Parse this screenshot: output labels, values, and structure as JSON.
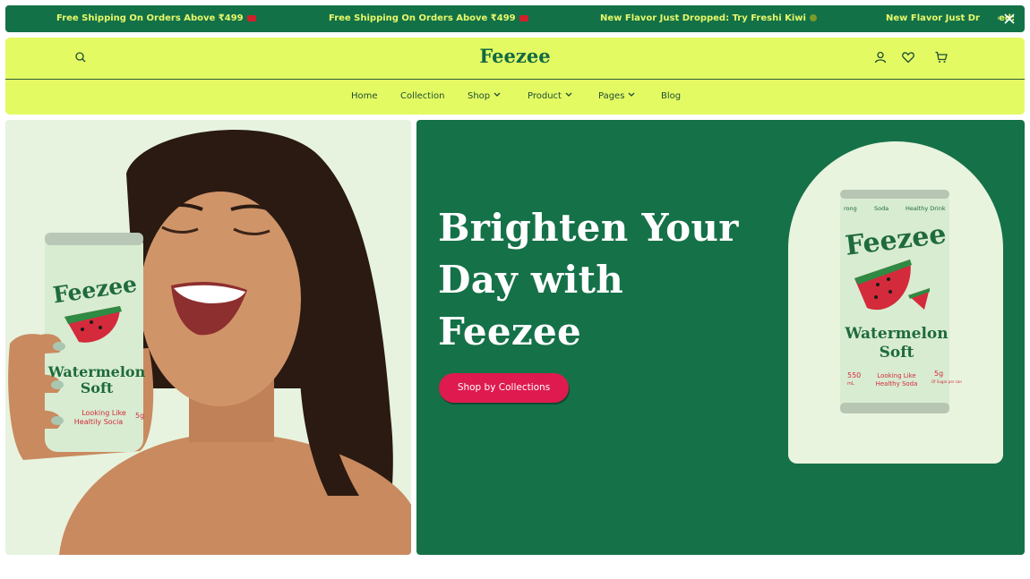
{
  "announcement": {
    "messages": [
      "Free Shipping On Orders Above ₹499",
      "Free Shipping On Orders Above ₹499",
      "New Flavor Just Dropped: Try Freshi Kiwi",
      "New Flavor Just Dropped:"
    ],
    "close_icon": "close-icon"
  },
  "header": {
    "logo": "Feezee",
    "icons": [
      "search-icon",
      "user-icon",
      "heart-icon",
      "cart-icon"
    ],
    "nav": [
      {
        "label": "Home",
        "dropdown": false
      },
      {
        "label": "Collection",
        "dropdown": false
      },
      {
        "label": "Shop",
        "dropdown": true
      },
      {
        "label": "Product",
        "dropdown": true
      },
      {
        "label": "Pages",
        "dropdown": true
      },
      {
        "label": "Blog",
        "dropdown": false
      }
    ]
  },
  "hero": {
    "headline_lines": [
      "Brighten Your",
      "Day with",
      "Feezee"
    ],
    "cta_label": "Shop by Collections",
    "left_can": {
      "brand": "Feezee",
      "flavor_line1": "Watermelon",
      "flavor_line2": "Soft",
      "tag_line1": "Looking Like",
      "tag_line2": "Healtily Socia",
      "stat": "5g"
    },
    "right_can": {
      "top_labels": [
        "rong",
        "Soda",
        "Healthy Drink"
      ],
      "brand": "Feezee",
      "flavor_line1": "Watermelon",
      "flavor_line2": "Soft",
      "volume": "550",
      "volume_unit": "mL",
      "tag_line1": "Looking Like",
      "tag_line2": "Healthy Soda",
      "sugar": "5g",
      "sugar_note": "Of Sugar per can"
    }
  },
  "colors": {
    "brand_green": "#137148",
    "lime": "#e4fa63",
    "cta_red": "#de1a4f",
    "can_mint": "#d8ecd2"
  }
}
